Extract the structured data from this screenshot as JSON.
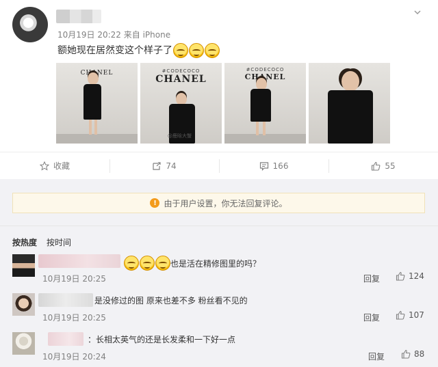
{
  "post": {
    "meta": "10月19日 20:22 来自 iPhone",
    "text": "额她现在居然变这个样子了",
    "photos": [
      {
        "brand": "CHANEL",
        "sub": ""
      },
      {
        "brand": "CHANEL",
        "sub": "#CODECOCO",
        "watermark": "@鹿晗大蟹"
      },
      {
        "brand": "CHANEL",
        "sub": "#CODECOCO"
      },
      {
        "brand": "",
        "sub": ""
      }
    ]
  },
  "actions": {
    "favorite": "收藏",
    "repost": "74",
    "comment": "166",
    "like": "55"
  },
  "notice": "由于用户设置，你无法回复评论。",
  "tabs": {
    "hot": "按热度",
    "time": "按时间"
  },
  "comments": [
    {
      "text": "也是活在精修图里的吗？",
      "time": "10月19日 20:25",
      "reply": "回复",
      "likes": "124"
    },
    {
      "text": "是没修过的图 原来也差不多 粉丝看不见的",
      "time": "10月19日 20:25",
      "reply": "回复",
      "likes": "107"
    },
    {
      "text": "：长相太英气的还是长发柔和一下好一点",
      "time": "10月19日 20:24",
      "reply": "回复",
      "likes": "88"
    }
  ],
  "colors": {
    "accent": "#f39b1c",
    "notice_bg": "#fdf8ea",
    "comments_bg": "#f2f2f5"
  }
}
